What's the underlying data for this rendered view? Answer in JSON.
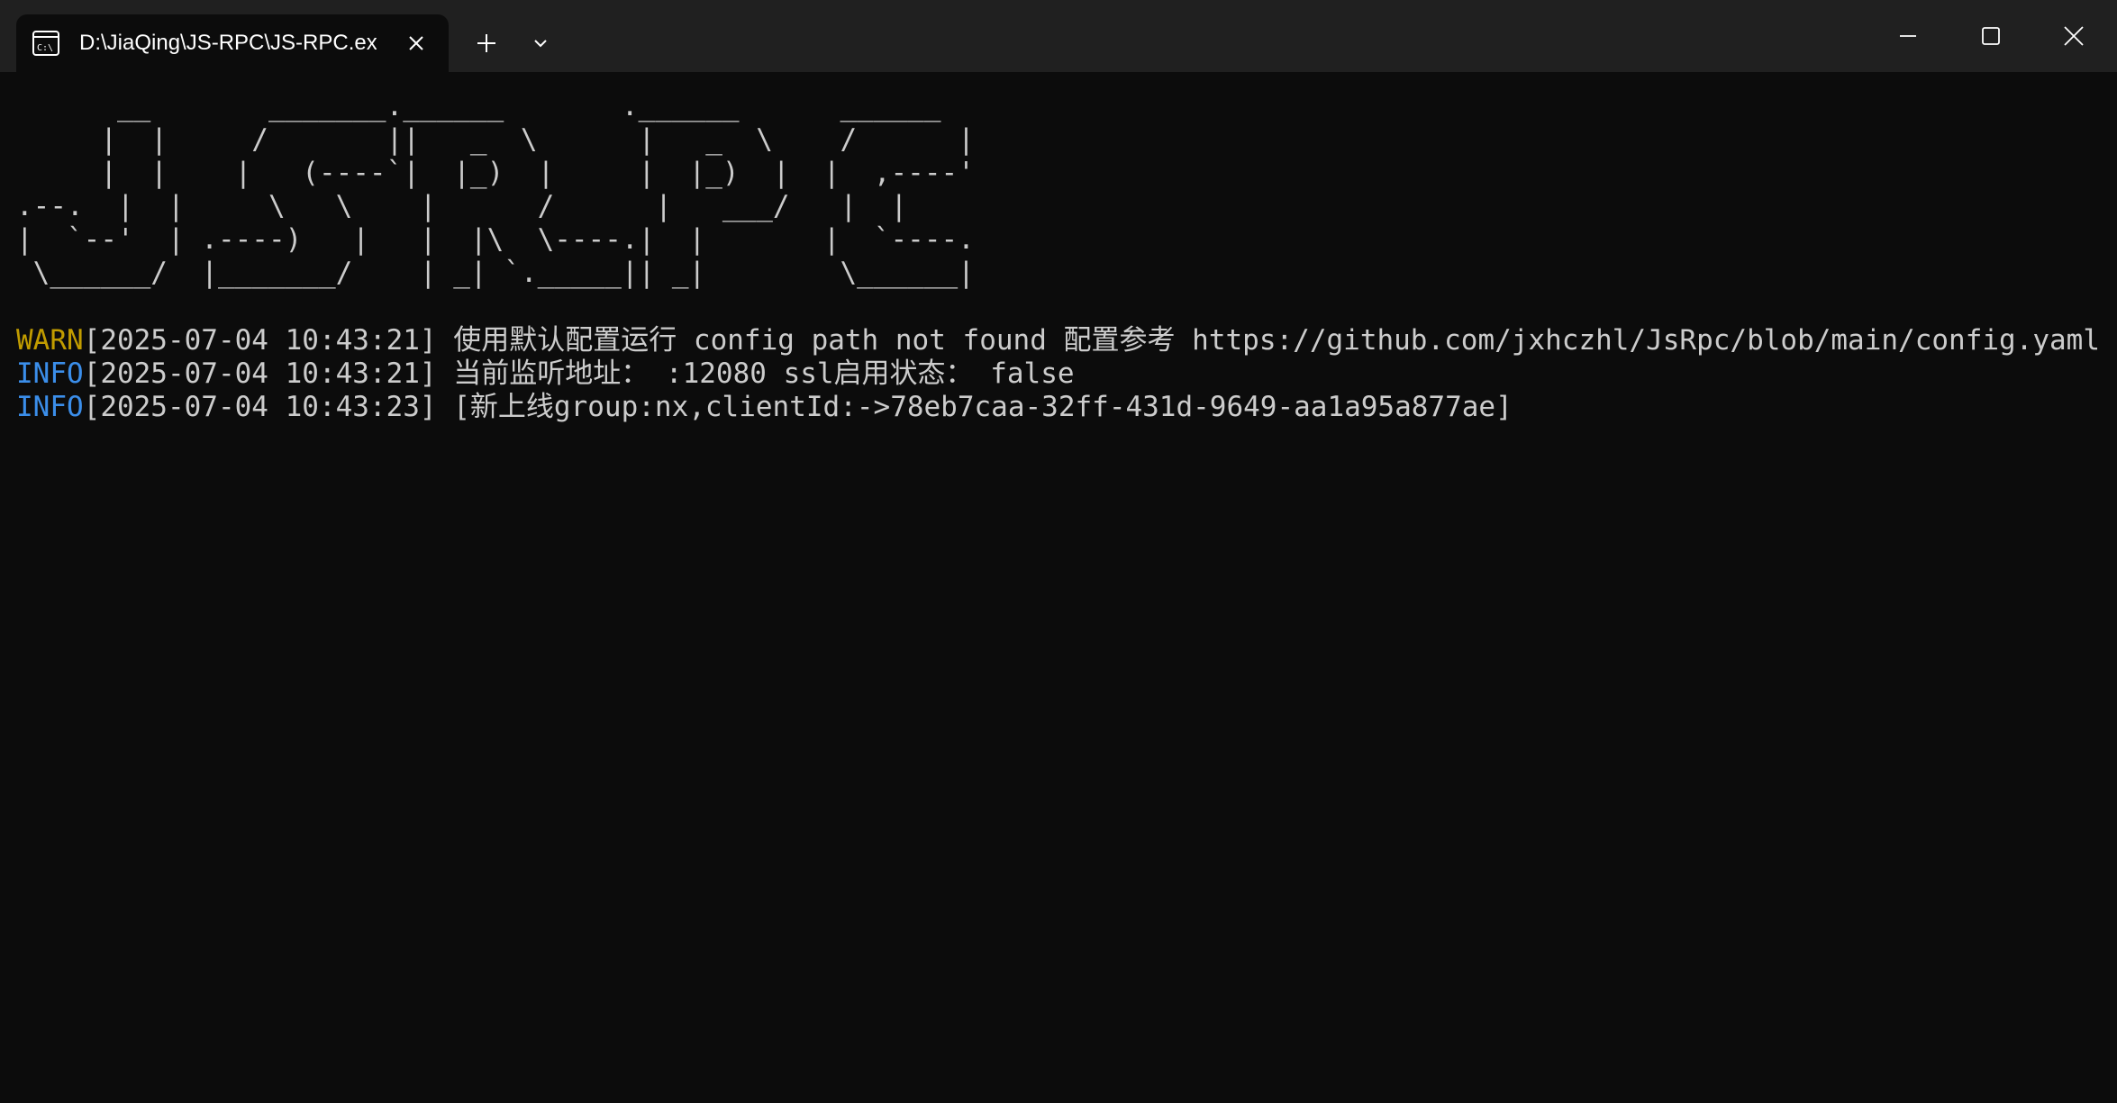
{
  "window": {
    "tab_title": "D:\\JiaQing\\JS-RPC\\JS-RPC.exe",
    "tab_icon": "cmd-icon",
    "close_tab_icon": "close-icon",
    "new_tab_icon": "plus-icon",
    "dropdown_icon": "chevron-down-icon",
    "minimize_icon": "minimize-icon",
    "maximize_icon": "maximize-icon",
    "close_window_icon": "close-icon"
  },
  "terminal": {
    "banner": "      __       _______.______       .______      ______\n     |  |     /       ||   _  \\      |   _  \\    /      |\n     |  |    |   (----`|  |_)  |     |  |_)  |  |  ,----'\n.--.  |  |     \\   \\    |      /      |   ___/   |  |\n|  `--'  | .----)   |   |  |\\  \\----.|  |       |  `----.\n \\______/  |_______/    | _| `._____|| _|        \\______|",
    "logs": [
      {
        "level": "WARN",
        "text": "[2025-07-04 10:43:21] 使用默认配置运行 config path not found 配置参考 https://github.com/jxhczhl/JsRpc/blob/main/config.yaml"
      },
      {
        "level": "INFO",
        "text": "[2025-07-04 10:43:21] 当前监听地址： :12080 ssl启用状态： false"
      },
      {
        "level": "INFO",
        "text": "[2025-07-04 10:43:23] [新上线group:nx,clientId:->78eb7caa-32ff-431d-9649-aa1a95a877ae]"
      }
    ]
  },
  "colors": {
    "background": "#0c0c0c",
    "titlebar": "#202020",
    "text": "#cccccc",
    "warn": "#c19c00",
    "info": "#3b8eea"
  }
}
